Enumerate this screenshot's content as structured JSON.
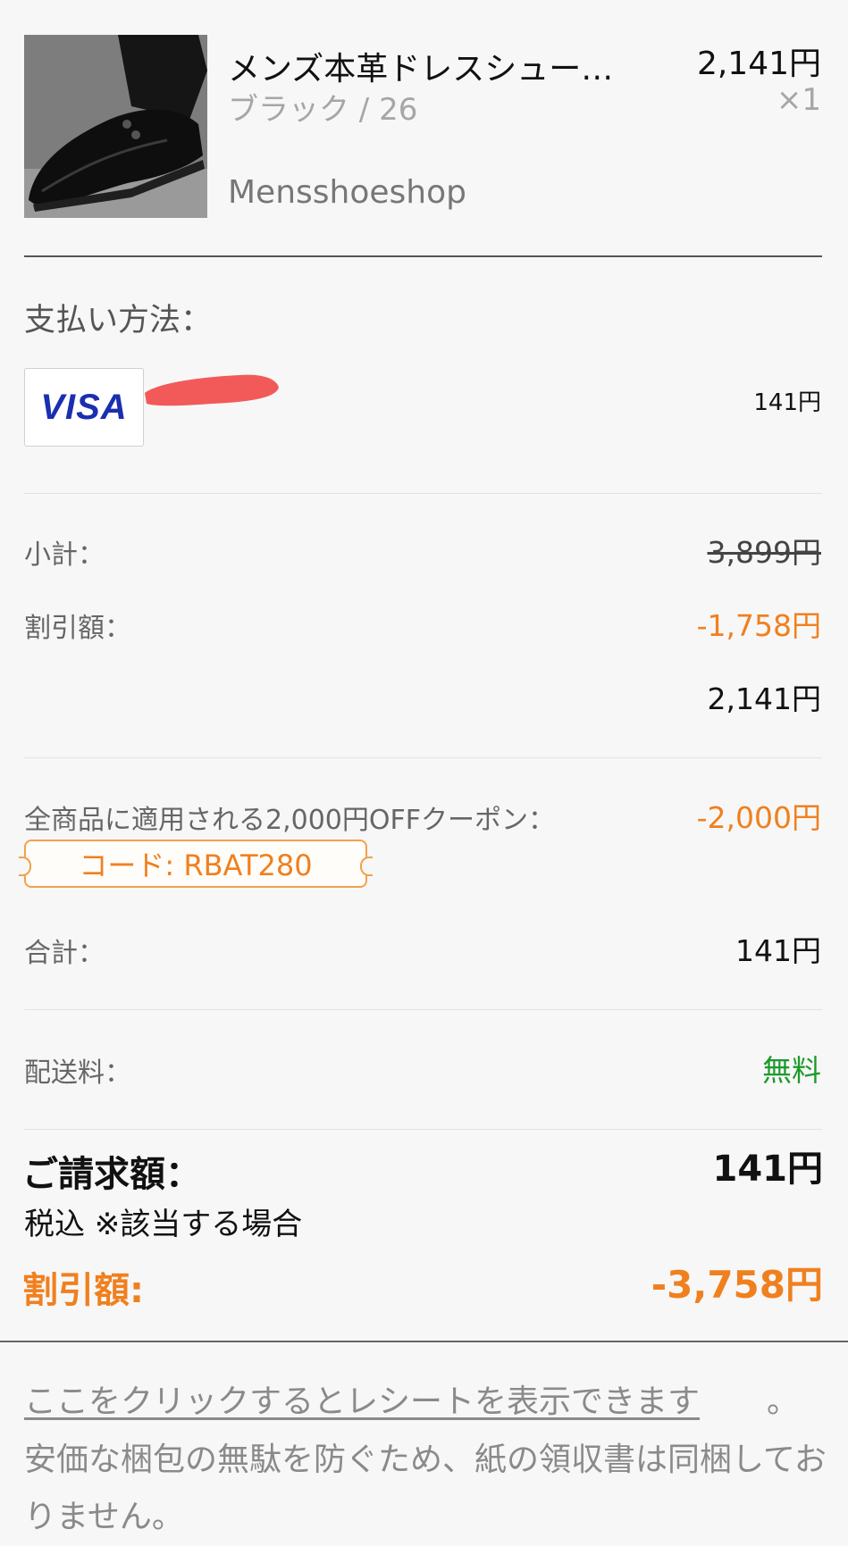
{
  "product": {
    "name": "メンズ本革ドレスシュー…",
    "variant": "ブラック / 26",
    "shop": "Mensshoeshop",
    "price": "2,141円",
    "quantity": "×1",
    "image_icon": "leather-shoe-image"
  },
  "payment": {
    "label": "支払い方法：",
    "card_brand": "VISA",
    "amount": "141円",
    "redaction_color": "#f25a5a"
  },
  "summary": {
    "subtotal_label": "小計：",
    "subtotal_value": "3,899円",
    "discount_label": "割引額：",
    "discount_value": "-1,758円",
    "after_discount_value": "2,141円"
  },
  "coupon": {
    "label": "全商品に適用される2,000円OFFクーポン：",
    "value": "-2,000円",
    "code": "コード: RBAT280"
  },
  "total": {
    "label": "合計：",
    "value": "141円"
  },
  "shipping": {
    "label": "配送料：",
    "value": "無料"
  },
  "billing": {
    "title": "ご請求額：",
    "amount": "141円",
    "tax_note": "税込 ※該当する場合",
    "discount_title": "割引額:",
    "discount_amount": "-3,758円"
  },
  "receipt": {
    "link_text": "ここをクリックするとレシートを表示できます",
    "period": "。",
    "note": "安価な梱包の無駄を防ぐため、紙の領収書は同梱しておりません。"
  },
  "colors": {
    "accent_orange": "#f0801f",
    "free_green": "#1c9a2c",
    "visa_blue": "#1a2fb0"
  }
}
